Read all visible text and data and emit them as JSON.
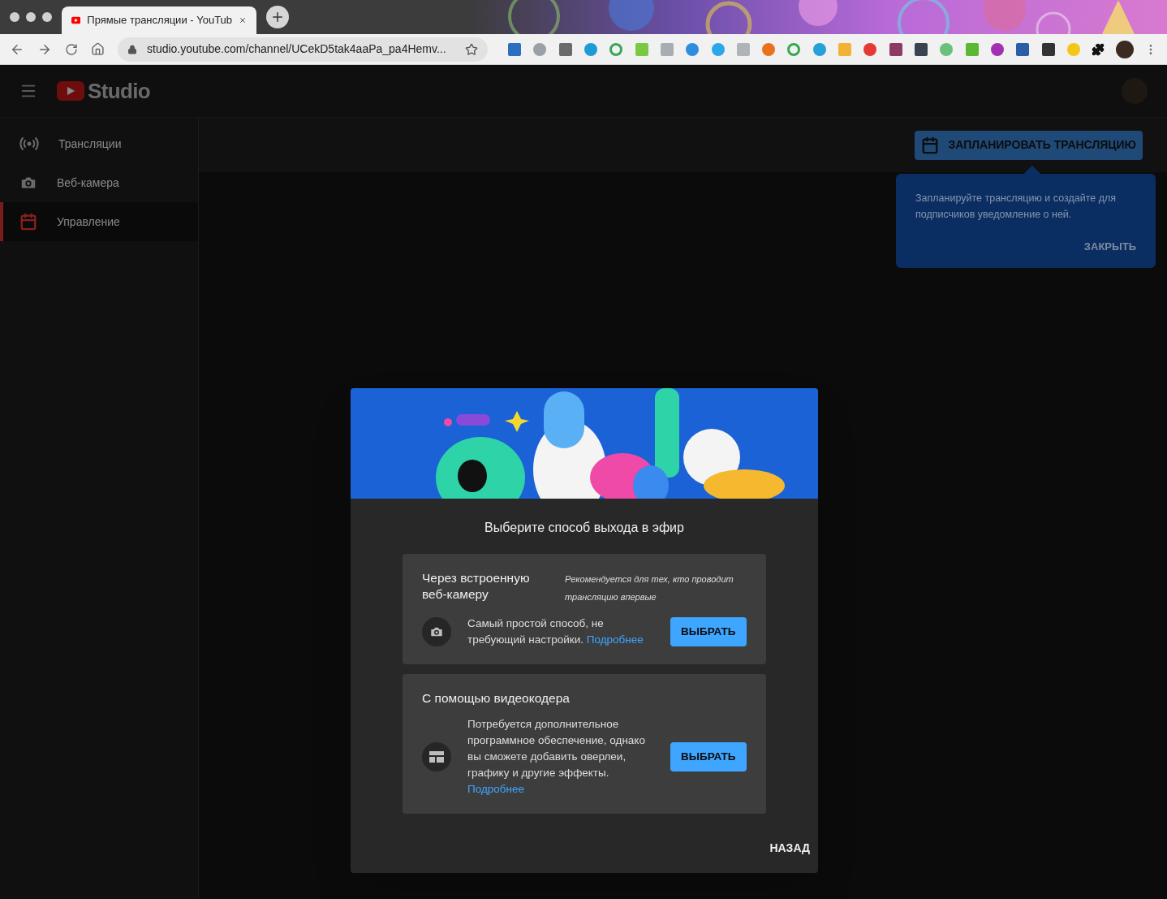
{
  "browser": {
    "tab": {
      "title": "Прямые трансляции - YouTub",
      "selected": true
    },
    "address": "studio.youtube.com/channel/UCekD5tak4aaPa_pa4Hemv..."
  },
  "header": {
    "logo_text": "Studio"
  },
  "sidebar": {
    "items": [
      {
        "kind": "broadcast",
        "label": "Трансляции",
        "selected": false
      },
      {
        "kind": "camera",
        "label": "Веб-камера",
        "selected": false
      },
      {
        "kind": "calendar",
        "label": "Управление",
        "selected": true
      }
    ]
  },
  "toolbar": {
    "schedule_button": "ЗАПЛАНИРОВАТЬ ТРАНСЛЯЦИЮ"
  },
  "tooltip": {
    "text": "Запланируйте трансляцию и создайте для подписчиков уведомление о ней.",
    "close": "ЗАКРЫТЬ"
  },
  "dialog": {
    "title": "Выберите способ выхода в эфир",
    "options": [
      {
        "kind": "webcam",
        "title": "Через встроенную веб-камеру",
        "note": "Рекомендуется для тех, кто проводит трансляцию впервые",
        "description": "Самый простой способ, не требующий настройки.",
        "link": "Подробнее",
        "button": "ВЫБРАТЬ"
      },
      {
        "kind": "encoder",
        "title": "С помощью видеокодера",
        "description": "Потребуется дополнительное программное обеспечение, однако вы сможете добавить оверлеи, графику и другие эффекты.",
        "link": "Подробнее",
        "button": "ВЫБРАТЬ"
      }
    ],
    "back": "НАЗАД"
  }
}
